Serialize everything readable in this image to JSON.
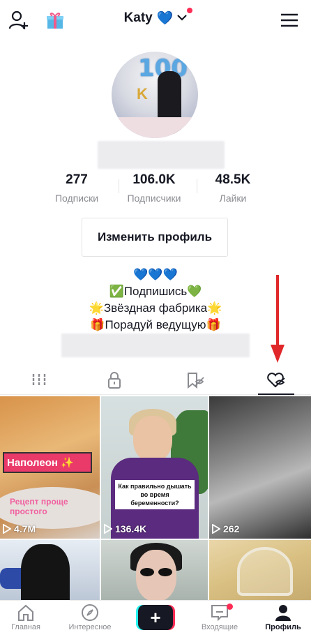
{
  "header": {
    "username": "Katy",
    "username_emoji": "💙"
  },
  "stats": [
    {
      "value": "277",
      "label": "Подписки"
    },
    {
      "value": "106.0K",
      "label": "Подписчики"
    },
    {
      "value": "48.5K",
      "label": "Лайки"
    }
  ],
  "edit_profile_label": "Изменить профиль",
  "bio": {
    "line1": "💙💙💙",
    "line2": "✅Подпишись💚",
    "line3": "🌟Звёздная фабрика🌟",
    "line4": "🎁Порадуй ведущую🎁"
  },
  "videos": [
    {
      "views": "4.7M",
      "tag": "Наполеон ✨",
      "subtitle": "Рецепт проще простого"
    },
    {
      "views": "136.4K",
      "caption": "Как правильно дышать во время беременности?"
    },
    {
      "views": "262"
    }
  ],
  "bottom_nav": {
    "home": "Главная",
    "discover": "Интересное",
    "inbox": "Входящие",
    "profile": "Профиль"
  },
  "colors": {
    "accent_red": "#fe2c55",
    "accent_cyan": "#25f4ee",
    "text_primary": "#161823",
    "text_secondary": "#8a8b91",
    "arrow_red": "#e0282a"
  }
}
